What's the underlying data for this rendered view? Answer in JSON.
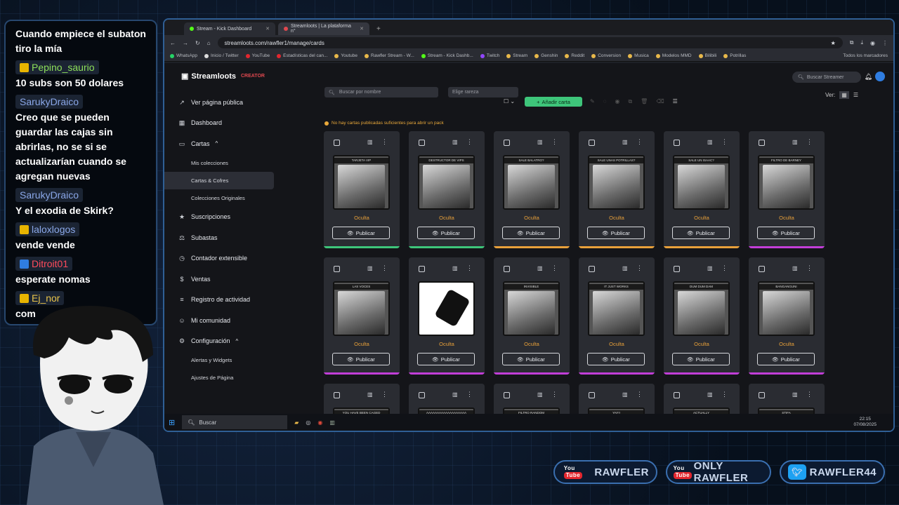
{
  "chat": [
    {
      "user": "",
      "text": "Cuando empiece el subaton tiro la mía"
    },
    {
      "user": "Pepino_saurio",
      "color": "#8ee05a",
      "badge": "#e8b400",
      "text": "10 subs son 50 dolares"
    },
    {
      "user": "SarukyDraico",
      "color": "#8aa7e8",
      "badge": "",
      "text": "Creo que se pueden guardar las cajas sin abrirlas, no se si se actualizarían cuando se agregan nuevas"
    },
    {
      "user": "SarukyDraico",
      "color": "#8aa7e8",
      "badge": "",
      "text": "Y el exodia de Skirk?"
    },
    {
      "user": "laloxlogos",
      "color": "#8aa7e8",
      "badge": "#e8b400",
      "text": "vende vende"
    },
    {
      "user": "Ditroit01",
      "color": "#ff4b5c",
      "badge": "#2f7de1",
      "text": "esperate nomas"
    },
    {
      "user": "Ej_nor",
      "color": "#e8c34a",
      "badge": "#e8b400",
      "text": "com"
    }
  ],
  "browser": {
    "tabs": [
      {
        "label": "Stream - Kick Dashboard"
      },
      {
        "label": "Streamloots | La plataforma n°"
      }
    ],
    "url": "streamloots.com/rawfler1/manage/cards",
    "bookmarks": [
      "WhatsApp",
      "Inicio / Twitter",
      "YouTube",
      "Estadísticas del can...",
      "Youtube",
      "Rawfler Stream - W...",
      "Stream - Kick Dashb...",
      "Twitch",
      "Stream",
      "Genshin",
      "Reddit",
      "Conversion",
      "Musica",
      "Modelos MMD",
      "Bilibili",
      "Potrillas"
    ],
    "all_bookmarks": "Todos los marcadores"
  },
  "app": {
    "logo": "Streamloots",
    "logo_sub": "CREATOR",
    "nav": [
      {
        "label": "Ver página pública",
        "icon": "↗"
      },
      {
        "label": "Dashboard",
        "icon": "▦"
      },
      {
        "label": "Cartas",
        "icon": "▭",
        "caret": "^"
      }
    ],
    "subnav1": [
      "Mis colecciones",
      "Cartas & Cofres",
      "Colecciones Originales"
    ],
    "nav2": [
      {
        "label": "Suscripciones",
        "icon": "★"
      },
      {
        "label": "Subastas",
        "icon": "⚖"
      },
      {
        "label": "Contador extensible",
        "icon": "◷"
      },
      {
        "label": "Ventas",
        "icon": "$"
      },
      {
        "label": "Registro de actividad",
        "icon": "≡"
      },
      {
        "label": "Mi comunidad",
        "icon": "☺"
      },
      {
        "label": "Configuración",
        "icon": "⚙",
        "caret": "^"
      }
    ],
    "subnav2": [
      "Alertas y Widgets",
      "Ajustes de Página"
    ],
    "search_placeholder": "Buscar por nombre",
    "rarity_placeholder": "Elige rareza",
    "add_card": "Añadir carta",
    "streamer_search": "Buscar Streamer",
    "view_label": "Ver:",
    "warning": "No hay cartas publicadas suficientes para abrir un pack"
  },
  "cards": [
    {
      "title": "TARJETA VIP",
      "status": "Oculta",
      "action": "Publicar",
      "rarity_color": "#3ec57a"
    },
    {
      "title": "DESTRUCTOR DE VIPS",
      "status": "Oculta",
      "action": "Publicar",
      "rarity_color": "#3ec57a"
    },
    {
      "title": "SALE BALATRO?",
      "status": "Oculta",
      "action": "Publicar",
      "rarity_color": "#e9a13a"
    },
    {
      "title": "SALE UNAS POTRILLAS?",
      "status": "Oculta",
      "action": "Publicar",
      "rarity_color": "#e9a13a"
    },
    {
      "title": "SALE UN ISAAC?",
      "status": "Oculta",
      "action": "Publicar",
      "rarity_color": "#e9a13a"
    },
    {
      "title": "FILTRO DE BARNEY",
      "status": "Oculta",
      "action": "Publicar",
      "rarity_color": "#c23ed8"
    },
    {
      "title": "LAS VOCES",
      "status": "Oculta",
      "action": "Publicar",
      "rarity_color": "#c23ed8"
    },
    {
      "title": "",
      "status": "Oculta",
      "action": "Publicar",
      "rarity_color": "#c23ed8"
    },
    {
      "title": "INVISIBLE",
      "status": "Oculta",
      "action": "Publicar",
      "rarity_color": "#c23ed8"
    },
    {
      "title": "IT JUST WORKS",
      "status": "Oculta",
      "action": "Publicar",
      "rarity_color": "#c23ed8"
    },
    {
      "title": "DUM DUM DAM",
      "status": "Oculta",
      "action": "Publicar",
      "rarity_color": "#c23ed8"
    },
    {
      "title": "BANGANGUNI",
      "status": "Oculta",
      "action": "Publicar",
      "rarity_color": "#c23ed8"
    },
    {
      "title": "YOU HAVE BEEN CAGED",
      "status": "",
      "action": "",
      "rarity_color": "#2a2c32"
    },
    {
      "title": "AAAAAAAAAAAAAAAAAAA",
      "status": "",
      "action": "",
      "rarity_color": "#2a2c32"
    },
    {
      "title": "FILTRO RANDOM",
      "status": "",
      "action": "",
      "rarity_color": "#2a2c32"
    },
    {
      "title": "YAY!!",
      "status": "",
      "action": "",
      "rarity_color": "#2a2c32"
    },
    {
      "title": "ACTUALLY",
      "status": "",
      "action": "",
      "rarity_color": "#2a2c32"
    },
    {
      "title": "STIFA",
      "status": "",
      "action": "",
      "rarity_color": "#2a2c32"
    }
  ],
  "taskbar": {
    "search": "Buscar",
    "time": "22:15",
    "date": "07/08/2025"
  },
  "socials": [
    {
      "platform": "You Tube",
      "handle": "RAWFLER"
    },
    {
      "platform": "You Tube",
      "handle": "ONLY RAWFLER"
    },
    {
      "platform": "twitter",
      "handle": "RAWFLER44"
    }
  ]
}
